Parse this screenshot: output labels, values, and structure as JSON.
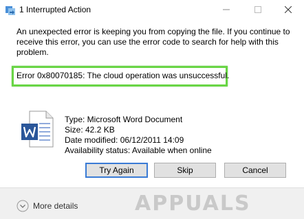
{
  "window": {
    "title": "1 Interrupted Action"
  },
  "dialog": {
    "message": "An unexpected error is keeping you from copying the file. If you continue to receive this error, you can use the error code to search for help with this problem.",
    "error_message": "Error 0x80070185: The cloud operation was unsuccessful."
  },
  "file": {
    "icon": "word-document-icon",
    "type": "Type: Microsoft Word Document",
    "size": "Size: 42.2 KB",
    "date_modified": "Date modified: 06/12/2011 14:09",
    "availability": "Availability status: Available when online"
  },
  "buttons": {
    "try_again": "Try Again",
    "skip": "Skip",
    "cancel": "Cancel"
  },
  "footer": {
    "more_details": "More details"
  },
  "watermark": {
    "text": "APPUALS"
  },
  "colors": {
    "highlight": "#69d545",
    "word_blue": "#2b579a",
    "default_button_border": "#3a7bd5"
  }
}
